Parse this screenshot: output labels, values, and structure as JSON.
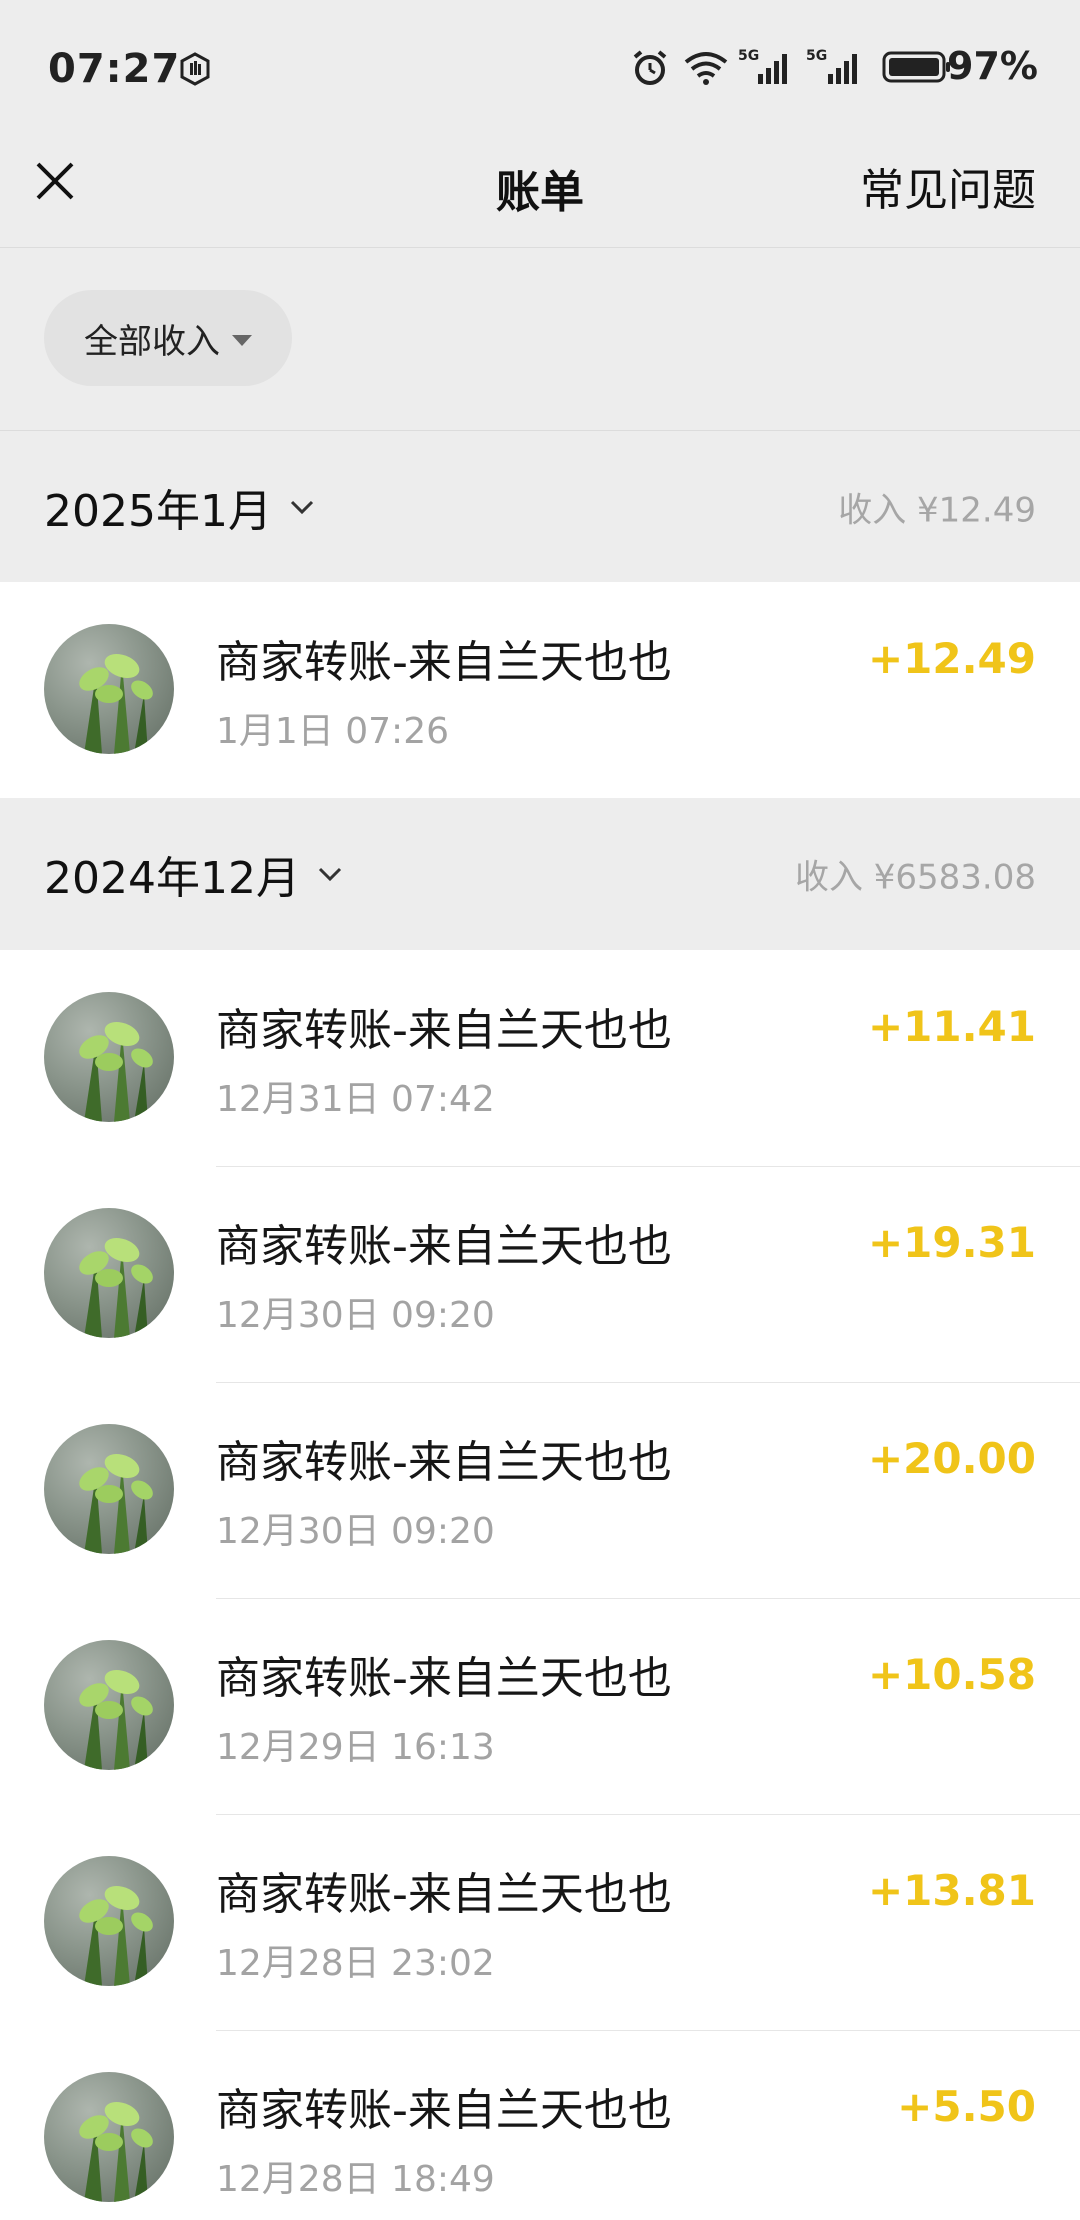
{
  "status_bar": {
    "time": "07:27",
    "battery_percent": "97%",
    "network_1": "5G",
    "network_2": "5G"
  },
  "nav": {
    "title": "账单",
    "faq_label": "常见问题"
  },
  "filter": {
    "label": "全部收入"
  },
  "months": [
    {
      "title": "2025年1月",
      "summary": "收入 ¥12.49",
      "transactions": [
        {
          "name": "商家转账-来自兰天也也",
          "time": "1月1日 07:26",
          "amount": "+12.49"
        }
      ]
    },
    {
      "title": "2024年12月",
      "summary": "收入 ¥6583.08",
      "transactions": [
        {
          "name": "商家转账-来自兰天也也",
          "time": "12月31日 07:42",
          "amount": "+11.41"
        },
        {
          "name": "商家转账-来自兰天也也",
          "time": "12月30日 09:20",
          "amount": "+19.31"
        },
        {
          "name": "商家转账-来自兰天也也",
          "time": "12月30日 09:20",
          "amount": "+20.00"
        },
        {
          "name": "商家转账-来自兰天也也",
          "time": "12月29日 16:13",
          "amount": "+10.58"
        },
        {
          "name": "商家转账-来自兰天也也",
          "time": "12月28日 23:02",
          "amount": "+13.81"
        },
        {
          "name": "商家转账-来自兰天也也",
          "time": "12月28日 18:49",
          "amount": "+5.50"
        }
      ]
    }
  ],
  "colors": {
    "income_amount": "#f0c419",
    "background": "#ededed",
    "secondary_text": "#a3a3a3"
  }
}
